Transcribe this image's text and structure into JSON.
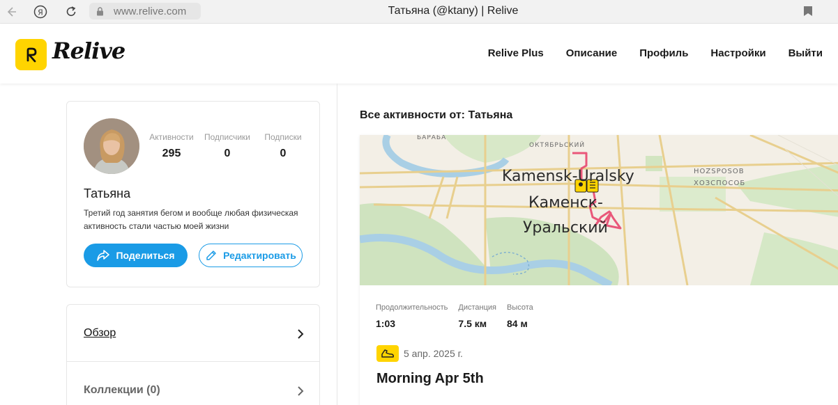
{
  "browser": {
    "url": "www.relive.com",
    "tab_title": "Татьяна (@ktany) | Relive",
    "icons": [
      "back-icon",
      "yandex-icon",
      "reload-icon",
      "lock-icon",
      "bookmark-icon"
    ]
  },
  "header": {
    "logo_text": "Relive",
    "nav": [
      "Relive Plus",
      "Описание",
      "Профиль",
      "Настройки",
      "Выйти"
    ],
    "brand_color": "#ffd400"
  },
  "profile": {
    "name": "Татьяна",
    "bio": "Третий год занятия бегом и вообще любая физическая активность стали частью моей жизни",
    "stats": [
      {
        "label": "Активности",
        "value": "295"
      },
      {
        "label": "Подписчики",
        "value": "0"
      },
      {
        "label": "Подписки",
        "value": "0"
      }
    ],
    "share_label": "Поделиться",
    "edit_label": "Редактировать",
    "accent_color": "#1a9be6"
  },
  "menu": {
    "items": [
      {
        "label": "Обзор"
      },
      {
        "label": "Коллекции (0)"
      }
    ]
  },
  "activities": {
    "title": "Все активности от: Татьяна",
    "map_labels": {
      "city_en": "Kamensk-Uralsky",
      "city_ru_1": "Каменск-",
      "city_ru_2": "Уральский",
      "district_1": "ОКТЯБРЬСКИЙ",
      "district_2": "БАРАБА",
      "district_3_en": "HOZSPOSOB",
      "district_3_ru": "ХОЗСПОСОБ"
    },
    "metrics": [
      {
        "label": "Продолжительность",
        "value": "1:03"
      },
      {
        "label": "Дистанция",
        "value": "7.5 км"
      },
      {
        "label": "Высота",
        "value": "84 м"
      }
    ],
    "date": "5 апр. 2025 г.",
    "name": "Morning Apr 5th",
    "route_color": "#e8466e"
  }
}
